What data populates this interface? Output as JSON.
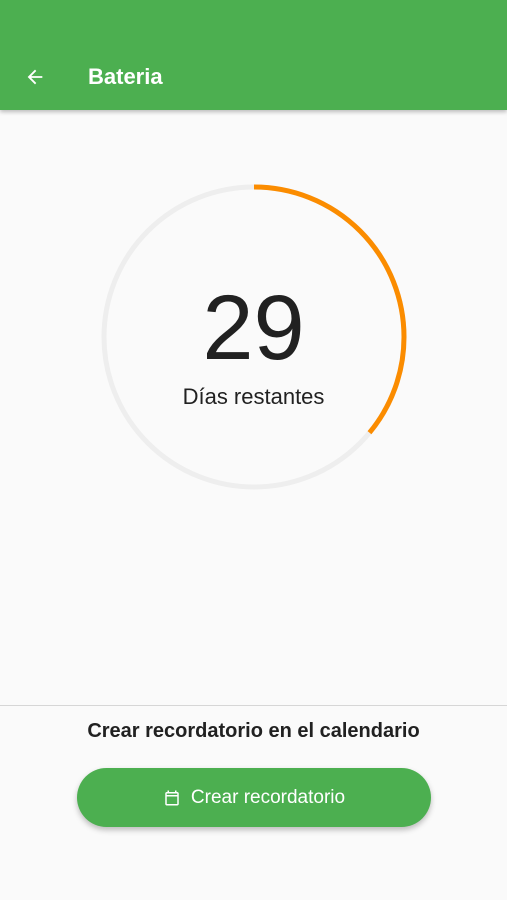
{
  "appbar": {
    "title": "Bateria",
    "back_icon": "arrow-left-icon",
    "color": "#4caf50"
  },
  "countdown": {
    "value": "29",
    "label": "Días restantes",
    "progress_fraction": 0.36,
    "track_color": "#eeeeee",
    "progress_color": "#fb8c00"
  },
  "reminder": {
    "title": "Crear recordatorio en el calendario",
    "button_label": "Crear recordatorio",
    "button_icon": "calendar-icon",
    "button_color": "#4caf50"
  }
}
